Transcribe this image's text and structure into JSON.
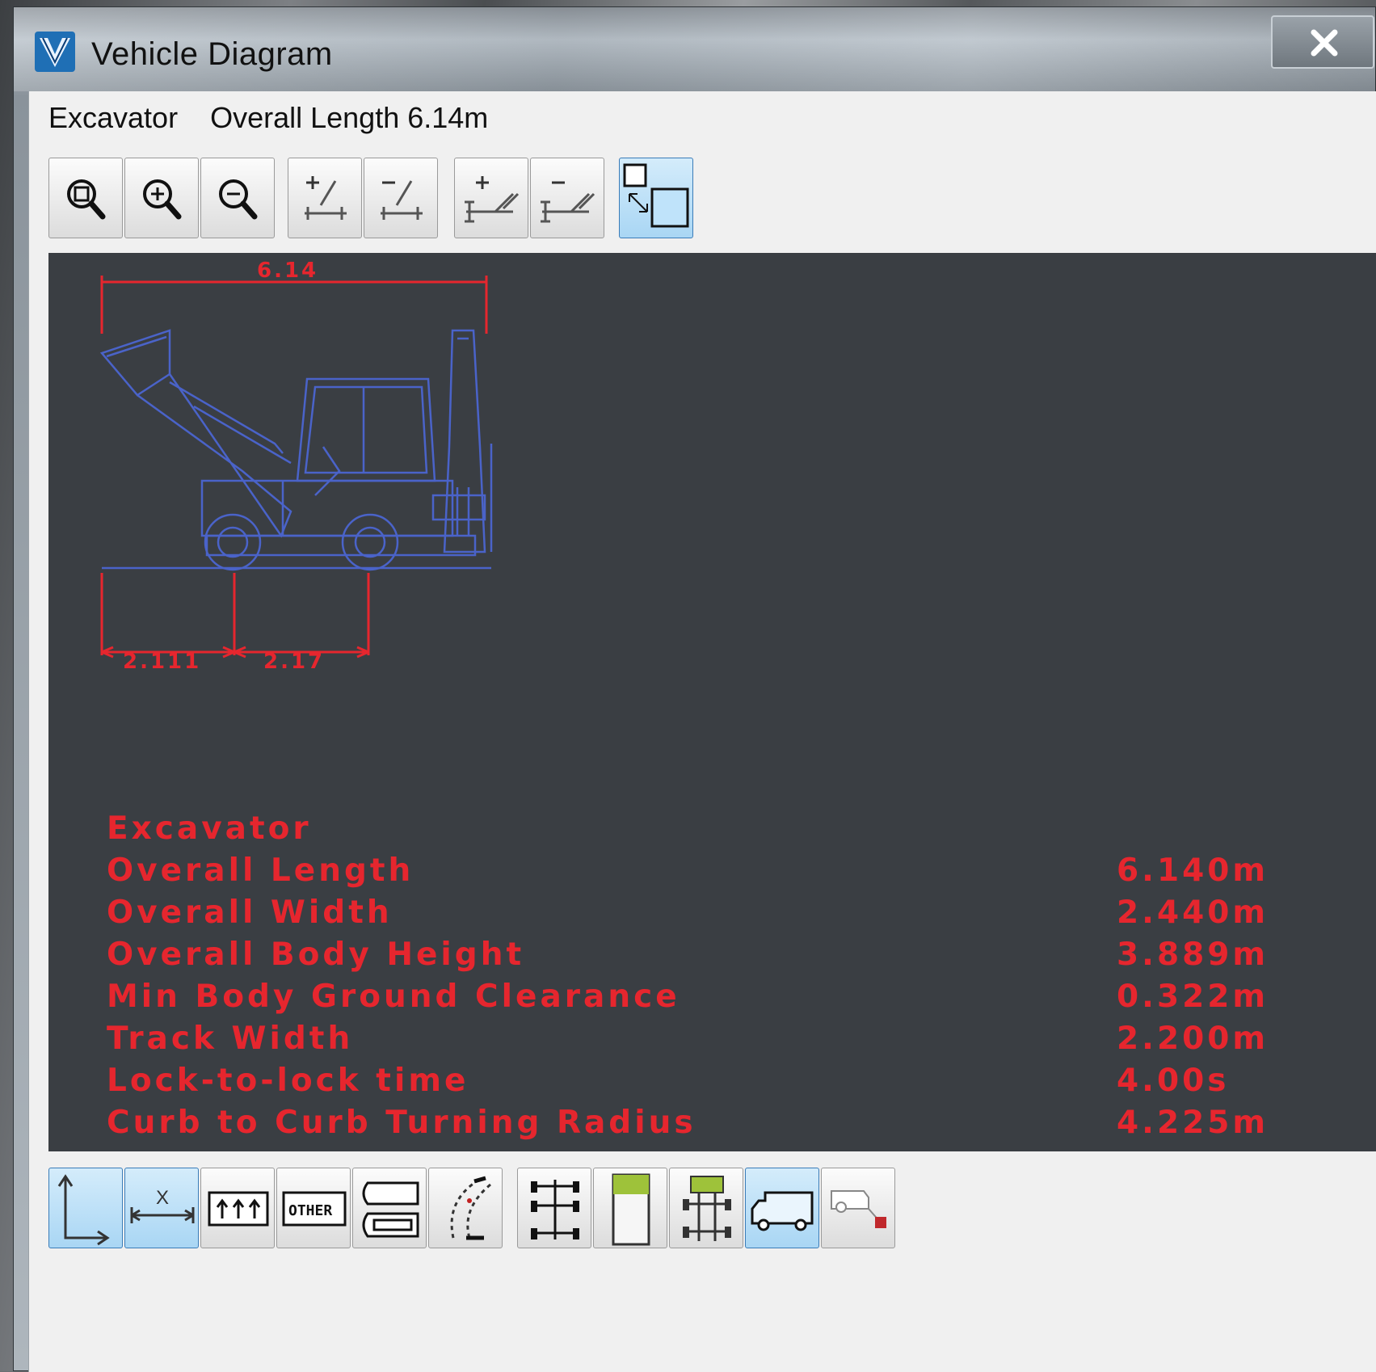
{
  "window": {
    "title": "Vehicle Diagram",
    "close_symbol": "X"
  },
  "info": {
    "vehicle_name": "Excavator",
    "overall_length_text": "Overall Length  6.14m"
  },
  "toolbar": {
    "icons": [
      "zoom-extents-icon",
      "zoom-in-icon",
      "zoom-out-icon",
      "add-axle-icon",
      "remove-axle-icon",
      "add-track-icon",
      "remove-track-icon",
      "resize-view-icon"
    ]
  },
  "diagram": {
    "overall_dim_label": "6.14",
    "front_overhang_label": "2.111",
    "wheelbase_label": "2.17",
    "colors": {
      "background": "#3a3e43",
      "vehicle_lines": "#4a63c9",
      "dimensions": "#e6262e"
    }
  },
  "specs": {
    "title": "Excavator",
    "rows": [
      {
        "label": "Overall Length",
        "value": "6.140m"
      },
      {
        "label": "Overall Width",
        "value": "2.440m"
      },
      {
        "label": "Overall Body Height",
        "value": "3.889m"
      },
      {
        "label": "Min Body Ground Clearance",
        "value": "0.322m"
      },
      {
        "label": "Track Width",
        "value": "2.200m"
      },
      {
        "label": "Lock-to-lock time",
        "value": "4.00s"
      },
      {
        "label": "Curb to Curb Turning Radius",
        "value": "4.225m"
      }
    ]
  },
  "bottom_toolbar": {
    "other_label": "OTHER",
    "x_label": "X",
    "icons": [
      "axis-origin-icon",
      "dimension-x-icon",
      "arrows-up-icon",
      "other-icon",
      "vehicle-parts-icon",
      "turn-path-icon",
      "axle-layout-icon",
      "top-view-icon",
      "chassis-icon",
      "truck-side-icon",
      "trailer-hitch-icon"
    ]
  }
}
